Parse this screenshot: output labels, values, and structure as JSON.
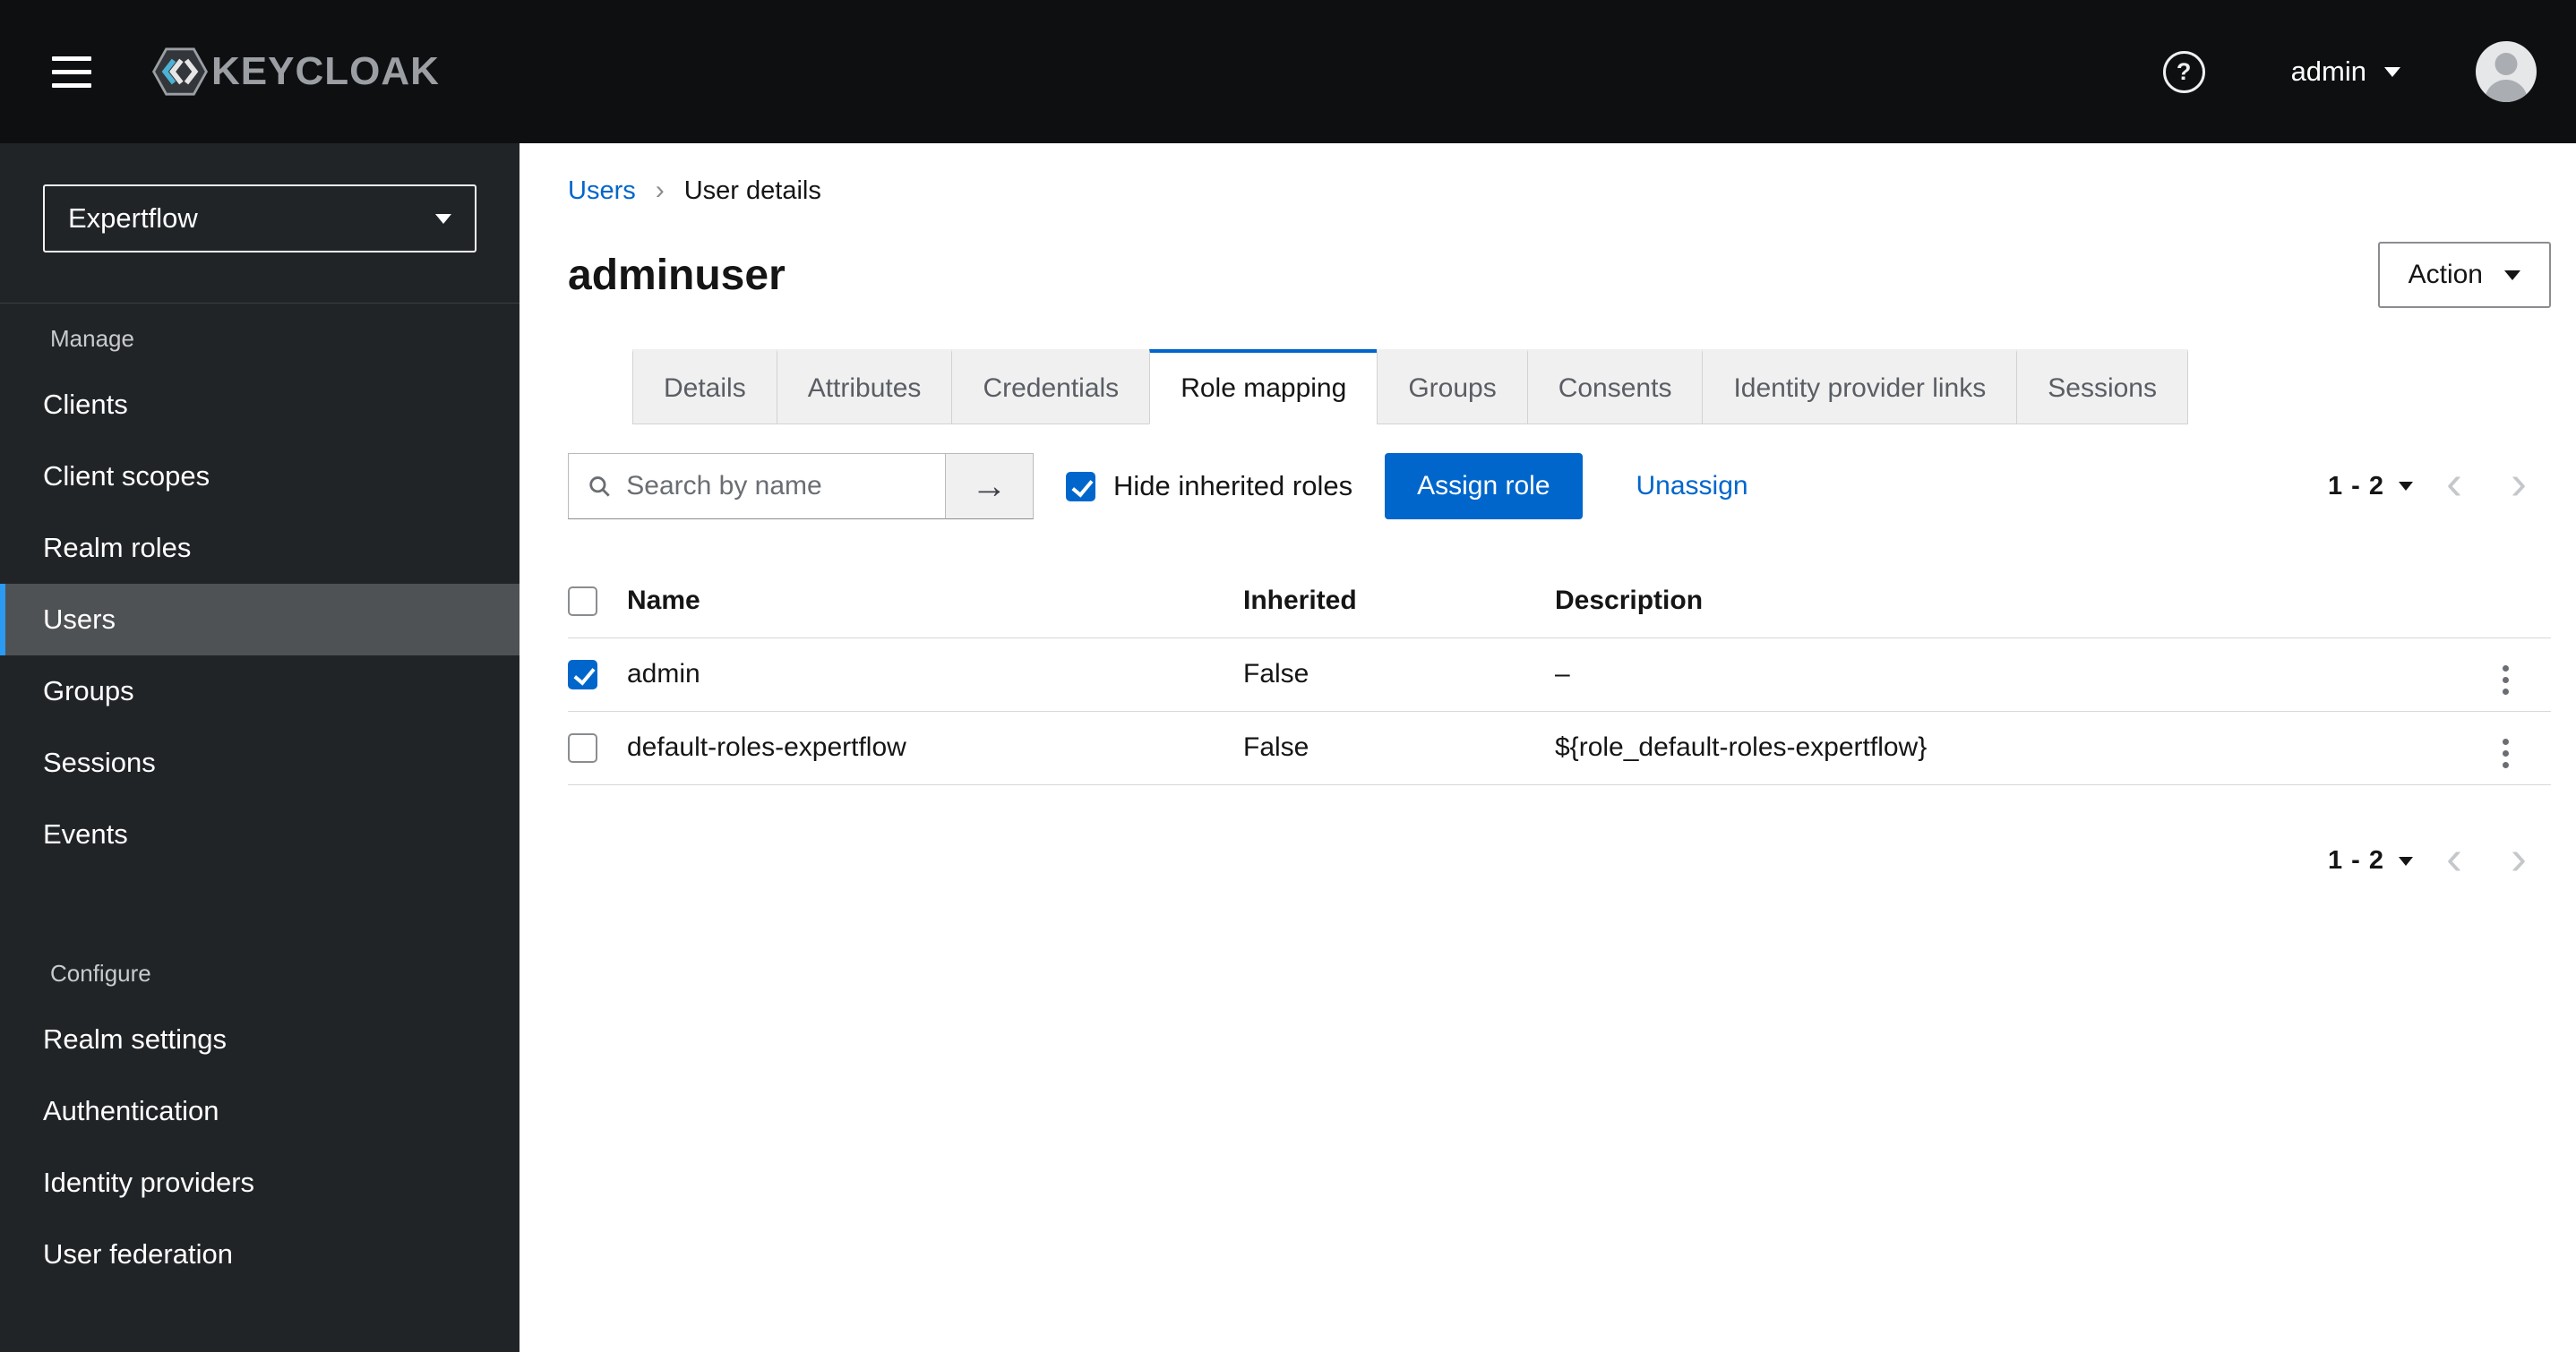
{
  "header": {
    "brand_text": "KEYCLOAK",
    "username": "admin"
  },
  "icons": {
    "help": "?",
    "arrow_right": "→",
    "chevron_left": "‹",
    "chevron_right": "›",
    "breadcrumb_separator": "›"
  },
  "sidebar": {
    "realm_selector": "Expertflow",
    "sections": [
      {
        "label": "Manage",
        "items": [
          {
            "label": "Clients",
            "active": false
          },
          {
            "label": "Client scopes",
            "active": false
          },
          {
            "label": "Realm roles",
            "active": false
          },
          {
            "label": "Users",
            "active": true
          },
          {
            "label": "Groups",
            "active": false
          },
          {
            "label": "Sessions",
            "active": false
          },
          {
            "label": "Events",
            "active": false
          }
        ]
      },
      {
        "label": "Configure",
        "items": [
          {
            "label": "Realm settings",
            "active": false
          },
          {
            "label": "Authentication",
            "active": false
          },
          {
            "label": "Identity providers",
            "active": false
          },
          {
            "label": "User federation",
            "active": false
          }
        ]
      }
    ]
  },
  "breadcrumb": {
    "parent": "Users",
    "current": "User details"
  },
  "page": {
    "title": "adminuser",
    "action_button": "Action"
  },
  "tabs": [
    {
      "label": "Details",
      "active": false
    },
    {
      "label": "Attributes",
      "active": false
    },
    {
      "label": "Credentials",
      "active": false
    },
    {
      "label": "Role mapping",
      "active": true
    },
    {
      "label": "Groups",
      "active": false
    },
    {
      "label": "Consents",
      "active": false
    },
    {
      "label": "Identity provider links",
      "active": false
    },
    {
      "label": "Sessions",
      "active": false
    }
  ],
  "toolbar": {
    "search_placeholder": "Search by name",
    "hide_inherited_label": "Hide inherited roles",
    "hide_inherited_checked": true,
    "assign_button": "Assign role",
    "unassign_link": "Unassign",
    "pagination_range": "1 - 2"
  },
  "table": {
    "columns": {
      "name": "Name",
      "inherited": "Inherited",
      "description": "Description"
    },
    "rows": [
      {
        "name": "admin",
        "inherited": "False",
        "description": "–",
        "checked": true
      },
      {
        "name": "default-roles-expertflow",
        "inherited": "False",
        "description": "${role_default-roles-expertflow}",
        "checked": false
      }
    ]
  },
  "footer": {
    "pagination_range": "1 - 2"
  },
  "colors": {
    "primary": "#0066cc",
    "link": "#0066cc",
    "header_bg": "#0d0f11",
    "sidebar_bg": "#212427",
    "nav_active_bg": "#4f5255",
    "nav_indicator": "#2b9af3",
    "tab_inactive_bg": "#f0f0f0"
  }
}
